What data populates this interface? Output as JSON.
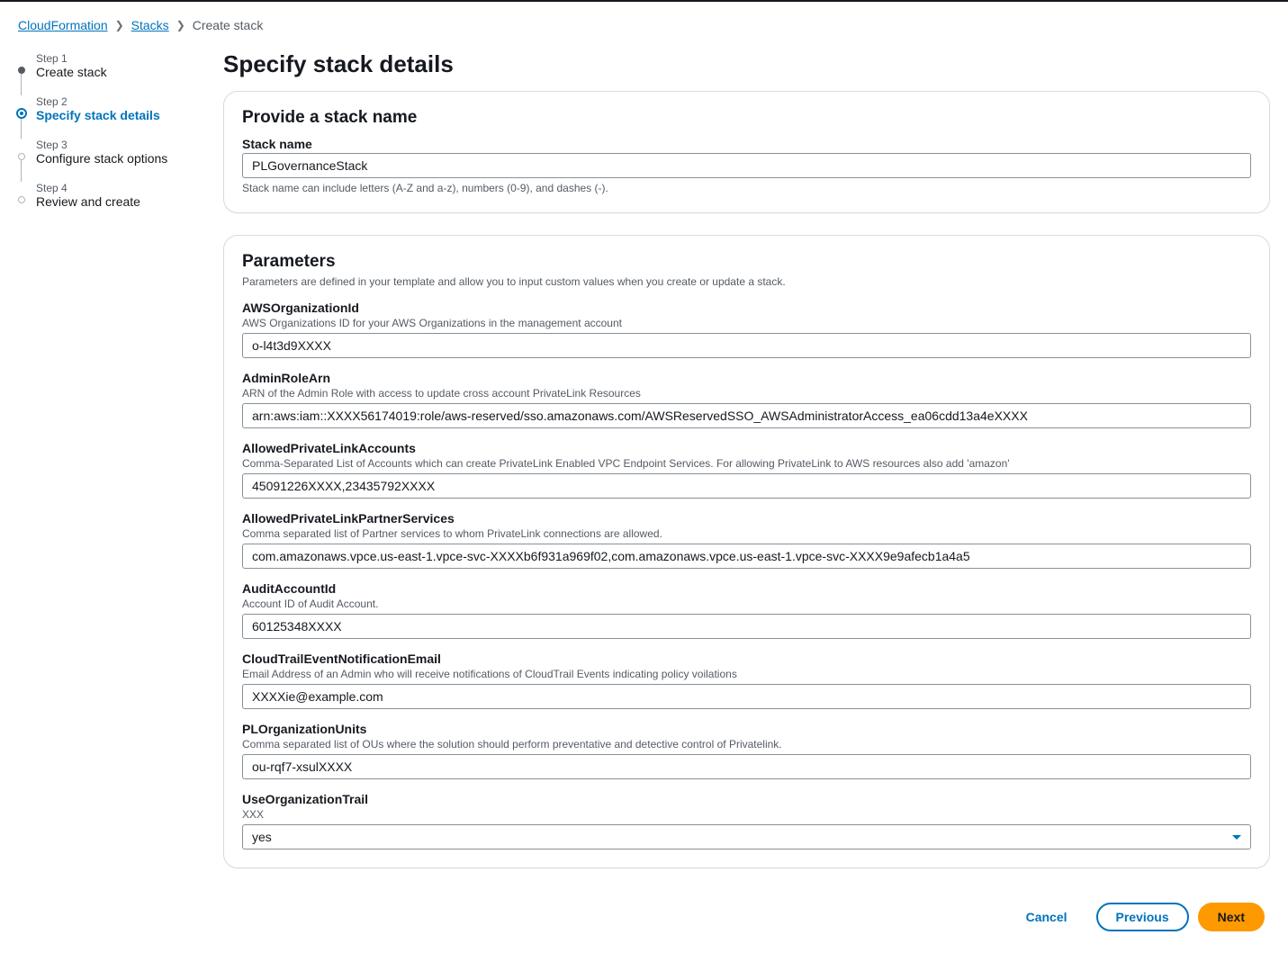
{
  "breadcrumbs": {
    "items": [
      "CloudFormation",
      "Stacks",
      "Create stack"
    ]
  },
  "wizard": {
    "steps": [
      {
        "num": "Step 1",
        "title": "Create stack"
      },
      {
        "num": "Step 2",
        "title": "Specify stack details"
      },
      {
        "num": "Step 3",
        "title": "Configure stack options"
      },
      {
        "num": "Step 4",
        "title": "Review and create"
      }
    ]
  },
  "page": {
    "title": "Specify stack details"
  },
  "stackNamePanel": {
    "heading": "Provide a stack name",
    "label": "Stack name",
    "value": "PLGovernanceStack",
    "hint": "Stack name can include letters (A-Z and a-z), numbers (0-9), and dashes (-)."
  },
  "parametersPanel": {
    "heading": "Parameters",
    "sub": "Parameters are defined in your template and allow you to input custom values when you create or update a stack.",
    "params": {
      "awsOrganizationId": {
        "label": "AWSOrganizationId",
        "desc": "AWS Organizations ID for your AWS Organizations in the management account",
        "value": "o-l4t3d9XXXX"
      },
      "adminRoleArn": {
        "label": "AdminRoleArn",
        "desc": "ARN of the Admin Role with access to update cross account PrivateLink Resources",
        "value": "arn:aws:iam::XXXX56174019:role/aws-reserved/sso.amazonaws.com/AWSReservedSSO_AWSAdministratorAccess_ea06cdd13a4eXXXX"
      },
      "allowedPrivateLinkAccounts": {
        "label": "AllowedPrivateLinkAccounts",
        "desc": "Comma-Separated List of Accounts which can create PrivateLink Enabled VPC Endpoint Services. For allowing PrivateLink to AWS resources also add 'amazon'",
        "value": "45091226XXXX,23435792XXXX"
      },
      "allowedPrivateLinkPartnerServices": {
        "label": "AllowedPrivateLinkPartnerServices",
        "desc": "Comma separated list of Partner services to whom PrivateLink connections are allowed.",
        "value": "com.amazonaws.vpce.us-east-1.vpce-svc-XXXXb6f931a969f02,com.amazonaws.vpce.us-east-1.vpce-svc-XXXX9e9afecb1a4a5"
      },
      "auditAccountId": {
        "label": "AuditAccountId",
        "desc": "Account ID of Audit Account.",
        "value": "60125348XXXX"
      },
      "cloudTrailEventNotificationEmail": {
        "label": "CloudTrailEventNotificationEmail",
        "desc": "Email Address of an Admin who will receive notifications of CloudTrail Events indicating policy voilations",
        "value": "XXXXie@example.com"
      },
      "plOrganizationUnits": {
        "label": "PLOrganizationUnits",
        "desc": "Comma separated list of OUs where the solution should perform preventative and detective control of Privatelink.",
        "value": "ou-rqf7-xsulXXXX"
      },
      "useOrganizationTrail": {
        "label": "UseOrganizationTrail",
        "desc": "XXX",
        "value": "yes"
      }
    }
  },
  "footer": {
    "cancel": "Cancel",
    "previous": "Previous",
    "next": "Next"
  }
}
